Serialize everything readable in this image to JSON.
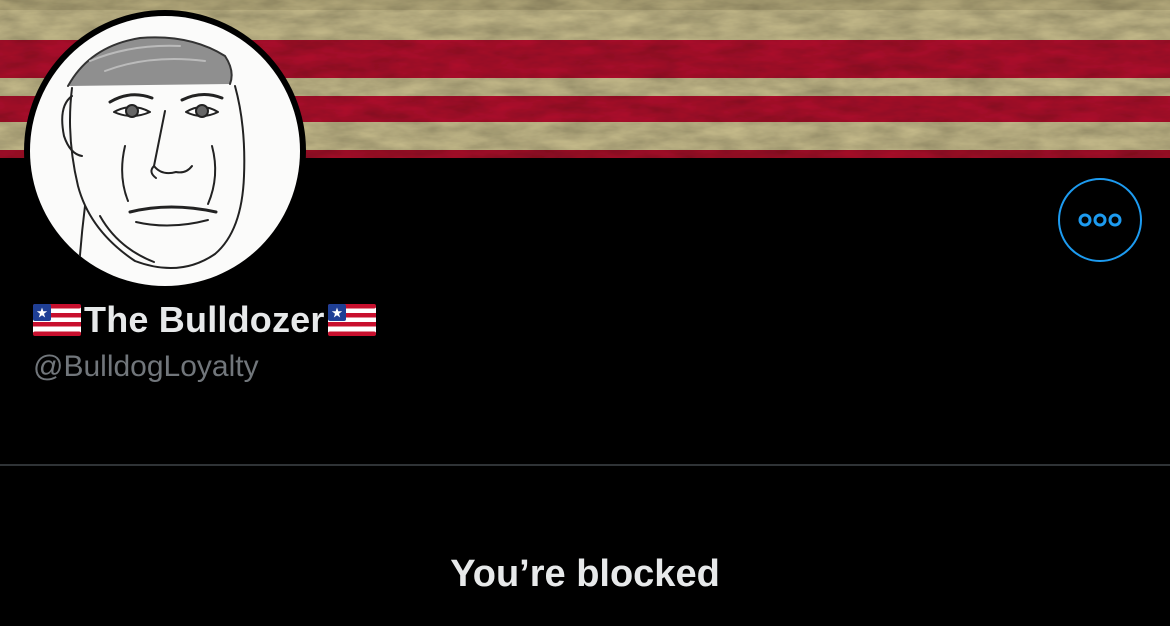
{
  "profile": {
    "display_name": "The Bulldozer",
    "name_prefix_emoji": "flag-emoji",
    "name_suffix_emoji": "flag-emoji",
    "handle": "@BulldogLoyalty"
  },
  "header": {
    "banner_theme": "distressed red and cream stripes"
  },
  "actions": {
    "more_icon": "more-horizontal-icon"
  },
  "status": {
    "title": "You’re blocked"
  },
  "colors": {
    "background": "#000000",
    "accent": "#1d9bf0",
    "primary_text": "#e7e9ea",
    "secondary_text": "#71767b",
    "divider": "#2f3336",
    "banner_red": "#b3122e",
    "banner_cream": "#c9bf8c"
  }
}
